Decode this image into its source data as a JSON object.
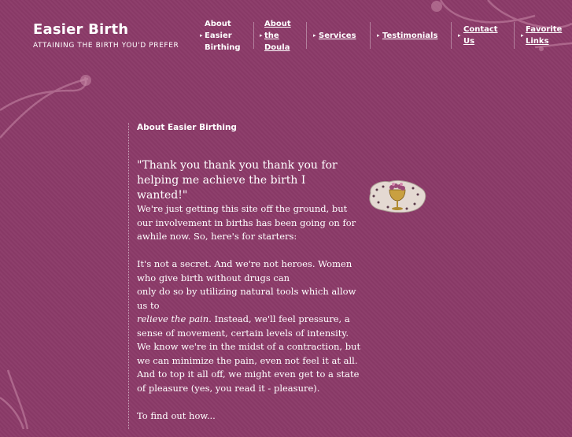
{
  "brand": {
    "title": "Easier Birth",
    "tagline": "ATTAINING THE BIRTH YOU'D PREFER"
  },
  "nav": {
    "about_easier": [
      "About",
      "Easier",
      "Birthing"
    ],
    "about_doula": [
      "About",
      "the",
      "Doula"
    ],
    "services": "Services",
    "testimonials": "Testimonials",
    "contact": [
      "Contact",
      "Us"
    ],
    "favorite": [
      "Favorite",
      "Links"
    ]
  },
  "content": {
    "section_title": "About Easier Birthing",
    "quote": "\"Thank you thank you thank you for helping me achieve the birth I wanted!\"",
    "para1": "We're just getting this site off the ground, but our involvement in births has been going on for awhile now. So, here's for starters:",
    "para2_a": "It's not a secret. And we're not heroes. Women who give birth without drugs can",
    "para2_b": "only do so by utilizing natural tools which allow us to",
    "para2_italic": "relieve the pain.",
    "para2_c": " Instead, we'll feel pressure, a sense of movement, certain levels of intensity. We know we're in the midst of a contraction, but we can minimize the pain, even not feel it at all. And to top it all off, we might even get to a state of pleasure (yes, you read it - pleasure).",
    "para3": "To find out how..."
  },
  "colors": {
    "background": "#8b3a68",
    "text": "#ffffff",
    "swirl": "#c98aa8"
  },
  "icons": {
    "nav_arrow": "arrow-right-icon",
    "graphic": "flower-goblet-graphic"
  }
}
